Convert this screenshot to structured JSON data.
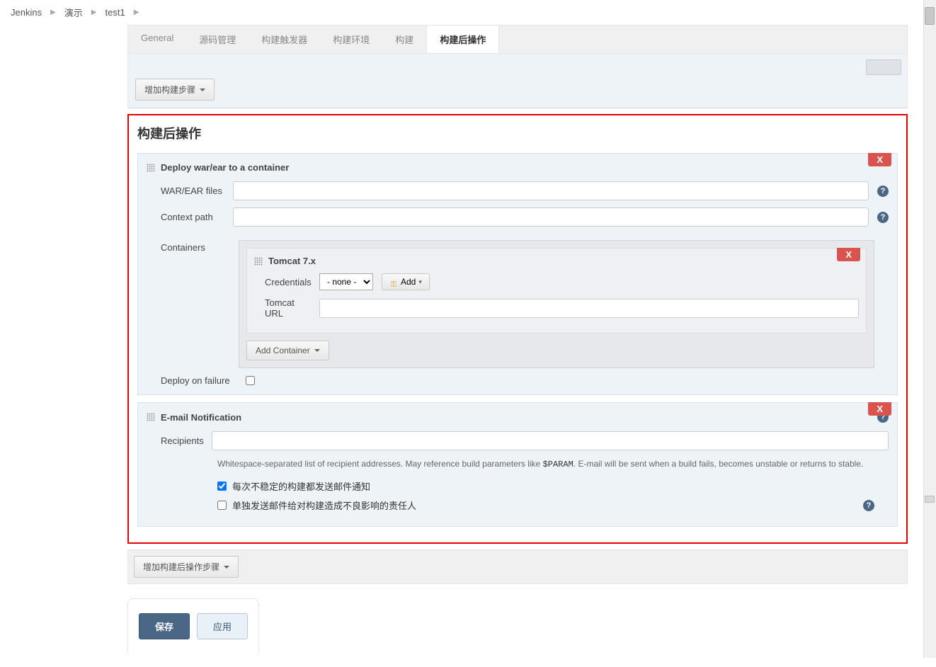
{
  "breadcrumb": {
    "items": [
      "Jenkins",
      "演示",
      "test1"
    ]
  },
  "tabs": {
    "items": [
      {
        "label": "General",
        "active": false
      },
      {
        "label": "源码管理",
        "active": false
      },
      {
        "label": "构建触发器",
        "active": false
      },
      {
        "label": "构建环境",
        "active": false
      },
      {
        "label": "构建",
        "active": false
      },
      {
        "label": "构建后操作",
        "active": true
      }
    ]
  },
  "add_build_step_label": "增加构建步骤",
  "section_title": "构建后操作",
  "deploy_block": {
    "title": "Deploy war/ear to a container",
    "delete_label": "X",
    "war_ear_label": "WAR/EAR files",
    "war_ear_value": "",
    "context_path_label": "Context path",
    "context_path_value": "",
    "containers_label": "Containers",
    "container": {
      "title": "Tomcat 7.x",
      "delete_label": "X",
      "credentials_label": "Credentials",
      "credentials_value": "- none -",
      "add_label": "Add",
      "tomcat_url_label": "Tomcat URL",
      "tomcat_url_value": ""
    },
    "add_container_label": "Add Container",
    "deploy_on_failure_label": "Deploy on failure",
    "deploy_on_failure_checked": false
  },
  "email_block": {
    "title": "E-mail Notification",
    "delete_label": "X",
    "recipients_label": "Recipients",
    "recipients_value": "",
    "help_text_prefix": "Whitespace-separated list of recipient addresses. May reference build parameters like ",
    "help_text_code": "$PARAM",
    "help_text_suffix": ". E-mail will be sent when a build fails, becomes unstable or returns to stable.",
    "unstable_notify_label": "每次不稳定的构建都发送邮件通知",
    "unstable_notify_checked": true,
    "individual_notify_label": "单独发送邮件给对构建造成不良影响的责任人",
    "individual_notify_checked": false
  },
  "add_post_build_label": "增加构建后操作步骤",
  "save_label": "保存",
  "apply_label": "应用"
}
